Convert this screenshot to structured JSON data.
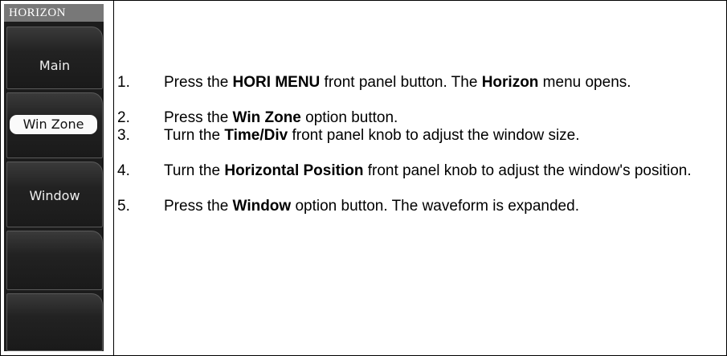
{
  "menu": {
    "title": "HORIZON",
    "buttons": [
      {
        "label": "Main"
      },
      {
        "label": "Win Zone"
      },
      {
        "label": "Window"
      },
      {
        "label": ""
      },
      {
        "label": ""
      }
    ]
  },
  "steps": [
    {
      "num": "1.",
      "parts": [
        {
          "t": "Press the "
        },
        {
          "t": "HORI MENU",
          "b": true
        },
        {
          "t": " front panel button. The "
        },
        {
          "t": "Horizon",
          "b": true
        },
        {
          "t": " menu opens."
        }
      ]
    },
    {
      "num": "2.",
      "parts": [
        {
          "t": "Press the "
        },
        {
          "t": "Win Zone",
          "b": true
        },
        {
          "t": " option button."
        }
      ]
    },
    {
      "num": "3.",
      "parts": [
        {
          "t": "Turn the "
        },
        {
          "t": "Time/Div",
          "b": true
        },
        {
          "t": " front panel knob to adjust the window size."
        }
      ]
    },
    {
      "num": "4.",
      "parts": [
        {
          "t": "Turn the "
        },
        {
          "t": "Horizontal Position",
          "b": true
        },
        {
          "t": " front panel knob to adjust the window's position."
        }
      ]
    },
    {
      "num": "5.",
      "parts": [
        {
          "t": "Press the "
        },
        {
          "t": "Window",
          "b": true
        },
        {
          "t": " option button. The waveform is expanded."
        }
      ]
    }
  ]
}
